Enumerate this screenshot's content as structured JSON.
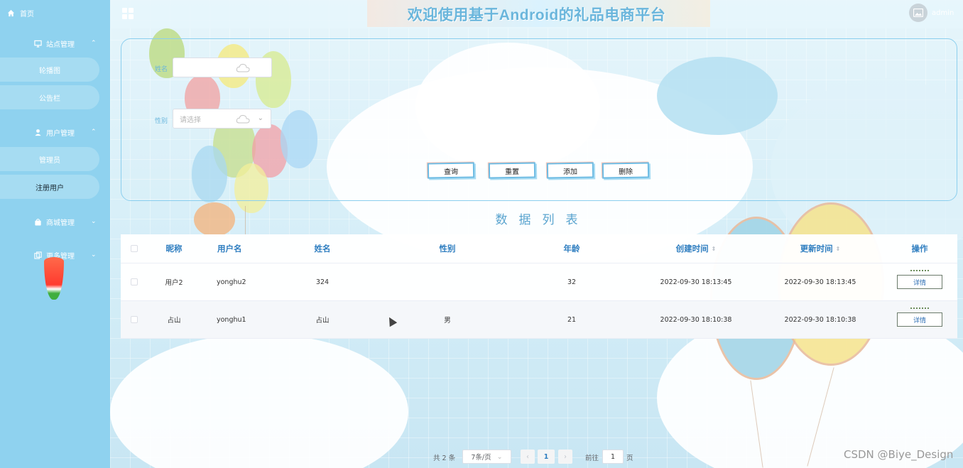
{
  "sidebar": {
    "home": "首页",
    "groups": [
      {
        "label": "站点管理",
        "items": [
          "轮播图",
          "公告栏"
        ]
      },
      {
        "label": "用户管理",
        "items": [
          "管理员",
          "注册用户"
        ]
      },
      {
        "label": "商城管理",
        "items": []
      },
      {
        "label": "更多管理",
        "items": []
      }
    ]
  },
  "header": {
    "title": "欢迎使用基于Android的礼品电商平台",
    "user": "admin"
  },
  "search": {
    "name_label": "姓名",
    "gender_label": "性别",
    "gender_placeholder": "请选择",
    "buttons": {
      "query": "查询",
      "reset": "重置",
      "add": "添加",
      "delete": "删除"
    }
  },
  "list": {
    "title": "数据列表",
    "columns": [
      "昵称",
      "用户名",
      "姓名",
      "性别",
      "年龄",
      "创建时间",
      "更新时间",
      "操作"
    ],
    "rows": [
      {
        "nickname": "用户2",
        "username": "yonghu2",
        "name": "324",
        "gender": "",
        "age": "32",
        "created": "2022-09-30 18:13:45",
        "updated": "2022-09-30 18:13:45",
        "action": "详情"
      },
      {
        "nickname": "占山",
        "username": "yonghu1",
        "name": "占山",
        "gender": "男",
        "age": "21",
        "created": "2022-09-30 18:10:38",
        "updated": "2022-09-30 18:10:38",
        "action": "详情"
      }
    ]
  },
  "pagination": {
    "total": "共 2 条",
    "page_size": "7条/页",
    "current": "1",
    "goto_label": "前往",
    "goto_value": "1",
    "page_unit": "页"
  },
  "watermark": "CSDN @Biye_Design",
  "colors": {
    "sidebar": "#8fd2ef",
    "accent": "#6ab6dc",
    "header_text": "#2f7ec0"
  }
}
